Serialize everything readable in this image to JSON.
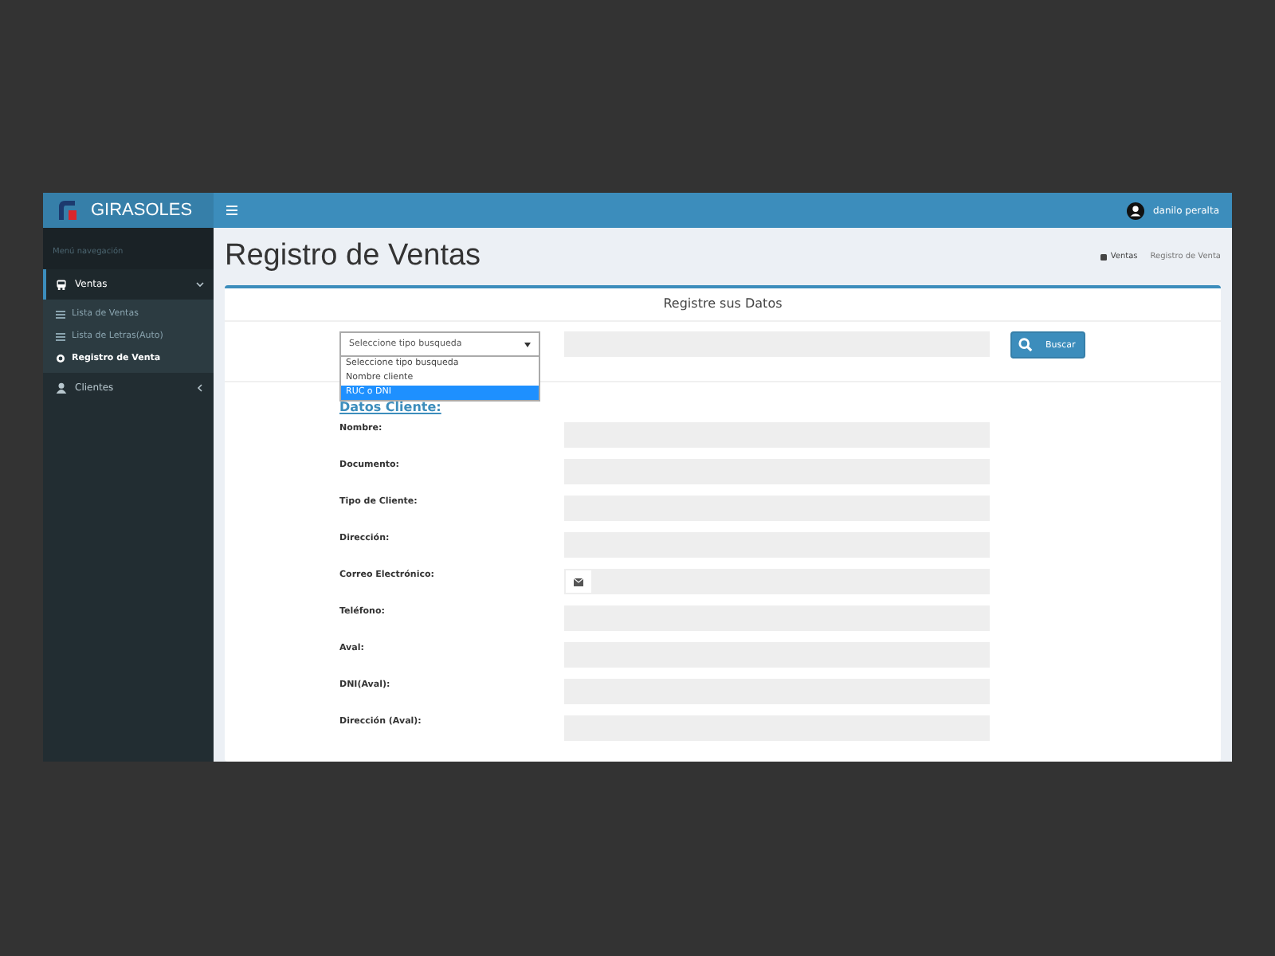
{
  "app": {
    "brand": "GIRASOLES",
    "user": "danilo peralta"
  },
  "sidebar": {
    "header": "Menú navegación",
    "items": [
      {
        "label": "Ventas",
        "expanded": true,
        "children": [
          {
            "label": "Lista de Ventas",
            "selected": false
          },
          {
            "label": "Lista de Letras(Auto)",
            "selected": false
          },
          {
            "label": "Registro de Venta",
            "selected": true
          }
        ]
      },
      {
        "label": "Clientes",
        "expanded": false
      }
    ]
  },
  "page": {
    "title": "Registro de Ventas",
    "breadcrumb": [
      "Ventas",
      "Registro de Venta"
    ]
  },
  "form": {
    "title": "Registre sus Datos",
    "search": {
      "select_value": "Seleccione tipo busqueda",
      "options": [
        {
          "label": "Seleccione tipo busqueda",
          "selected": false
        },
        {
          "label": "Nombre cliente",
          "selected": false
        },
        {
          "label": "RUC o DNI",
          "selected": true
        }
      ],
      "button": "Buscar"
    },
    "section": "Datos Cliente:",
    "fields": [
      {
        "label": "Nombre:",
        "kind": "text"
      },
      {
        "label": "Documento:",
        "kind": "text"
      },
      {
        "label": "Tipo de Cliente:",
        "kind": "text"
      },
      {
        "label": "Dirección:",
        "kind": "text"
      },
      {
        "label": "Correo Electrónico:",
        "kind": "email"
      },
      {
        "label": "Teléfono:",
        "kind": "text"
      },
      {
        "label": "Aval:",
        "kind": "text"
      },
      {
        "label": "DNI(Aval):",
        "kind": "text"
      },
      {
        "label": "Dirección (Aval):",
        "kind": "text"
      }
    ]
  }
}
